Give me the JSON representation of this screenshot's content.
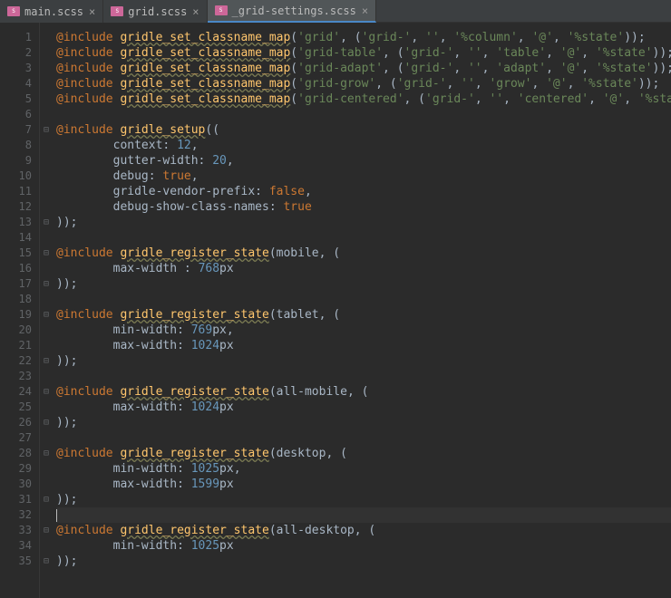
{
  "tabs": [
    {
      "label": "main.scss",
      "active": false
    },
    {
      "label": "grid.scss",
      "active": false
    },
    {
      "label": "_grid-settings.scss",
      "active": true
    }
  ],
  "gutter": [
    "1",
    "2",
    "3",
    "4",
    "5",
    "6",
    "7",
    "8",
    "9",
    "10",
    "11",
    "12",
    "13",
    "14",
    "15",
    "16",
    "17",
    "18",
    "19",
    "20",
    "21",
    "22",
    "23",
    "24",
    "25",
    "26",
    "27",
    "28",
    "29",
    "30",
    "31",
    "32",
    "33",
    "34",
    "35"
  ],
  "fold": [
    "",
    "",
    "",
    "",
    "",
    "",
    "⊟",
    "",
    "",
    "",
    "",
    "",
    "⊟",
    "",
    "⊟",
    "",
    "⊟",
    "",
    "⊟",
    "",
    "",
    "⊟",
    "",
    "⊟",
    "",
    "⊟",
    "",
    "⊟",
    "",
    "",
    "⊟",
    "",
    "⊟",
    "",
    "⊟"
  ],
  "code": {
    "l1": {
      "inc": "@include",
      "fn": "gridle_set_classname_map",
      "args": [
        "'grid'",
        "'grid-'",
        "''",
        "'%column'",
        "'@'",
        "'%state'"
      ]
    },
    "l2": {
      "inc": "@include",
      "fn": "gridle_set_classname_map",
      "args": [
        "'grid-table'",
        "'grid-'",
        "''",
        "'table'",
        "'@'",
        "'%state'"
      ]
    },
    "l3": {
      "inc": "@include",
      "fn": "gridle_set_classname_map",
      "args": [
        "'grid-adapt'",
        "'grid-'",
        "''",
        "'adapt'",
        "'@'",
        "'%state'"
      ]
    },
    "l4": {
      "inc": "@include",
      "fn": "gridle_set_classname_map",
      "args": [
        "'grid-grow'",
        "'grid-'",
        "''",
        "'grow'",
        "'@'",
        "'%state'"
      ]
    },
    "l5": {
      "inc": "@include",
      "fn": "gridle_set_classname_map",
      "args": [
        "'grid-centered'",
        "'grid-'",
        "''",
        "'centered'",
        "'@'",
        "'%state'"
      ]
    },
    "l7": {
      "inc": "@include",
      "fn": "gridle_setup",
      "tail": "(("
    },
    "l8": {
      "prop": "context",
      "val": "12"
    },
    "l9": {
      "prop": "gutter-width",
      "val": "20"
    },
    "l10": {
      "prop": "debug",
      "val": "true"
    },
    "l11": {
      "prop": "gridle-vendor-prefix",
      "val": "false"
    },
    "l12": {
      "prop": "debug-show-class-names",
      "val": "true"
    },
    "l13": "));",
    "l15": {
      "inc": "@include",
      "fn": "gridle_register_state",
      "param": "mobile"
    },
    "l16": {
      "prop": "max-width ",
      "val": "768",
      "unit": "px"
    },
    "l17": "));",
    "l19": {
      "inc": "@include",
      "fn": "gridle_register_state",
      "param": "tablet"
    },
    "l20": {
      "prop": "min-width",
      "val": "769",
      "unit": "px",
      "comma": ","
    },
    "l21": {
      "prop": "max-width",
      "val": "1024",
      "unit": "px"
    },
    "l22": "));",
    "l24": {
      "inc": "@include",
      "fn": "gridle_register_state",
      "param": "all-mobile"
    },
    "l25": {
      "prop": "max-width",
      "val": "1024",
      "unit": "px"
    },
    "l26": "));",
    "l28": {
      "inc": "@include",
      "fn": "gridle_register_state",
      "param": "desktop"
    },
    "l29": {
      "prop": "min-width",
      "val": "1025",
      "unit": "px",
      "comma": ","
    },
    "l30": {
      "prop": "max-width",
      "val": "1599",
      "unit": "px"
    },
    "l31": "));",
    "l33": {
      "inc": "@include",
      "fn": "gridle_register_state",
      "param": "all-desktop"
    },
    "l34": {
      "prop": "min-width",
      "val": "1025",
      "unit": "px"
    },
    "l35": "));"
  }
}
